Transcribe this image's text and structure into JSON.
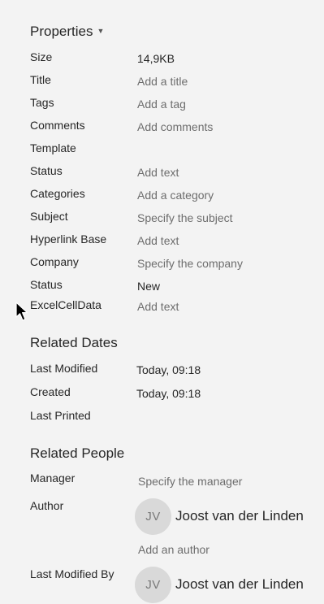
{
  "properties": {
    "title": "Properties",
    "caret_icon": "chevron-down-icon",
    "rows": [
      {
        "label": "Size",
        "value": "14,9KB"
      },
      {
        "label": "Title",
        "value": "Add a title"
      },
      {
        "label": "Tags",
        "value": "Add a tag"
      },
      {
        "label": "Comments",
        "value": "Add comments"
      },
      {
        "label": "Template",
        "value": ""
      },
      {
        "label": "Status",
        "value": "Add text"
      },
      {
        "label": "Categories",
        "value": "Add a category"
      },
      {
        "label": "Subject",
        "value": "Specify the subject"
      },
      {
        "label": "Hyperlink Base",
        "value": "Add text"
      },
      {
        "label": "Company",
        "value": "Specify the company"
      },
      {
        "label": "Status",
        "value": "New"
      },
      {
        "label": "ExcelCellData",
        "value": "Add text"
      }
    ]
  },
  "related_dates": {
    "title": "Related Dates",
    "rows": [
      {
        "label": "Last Modified",
        "value": "Today, 09:18"
      },
      {
        "label": "Created",
        "value": "Today, 09:18"
      },
      {
        "label": "Last Printed",
        "value": ""
      }
    ]
  },
  "related_people": {
    "title": "Related People",
    "manager": {
      "label": "Manager",
      "value": "Specify the manager"
    },
    "author": {
      "label": "Author",
      "initials": "JV",
      "name": "Joost van der Linden",
      "add_label": "Add an author"
    },
    "last_modified_by": {
      "label": "Last Modified By",
      "initials": "JV",
      "name": "Joost van der Linden"
    }
  },
  "colors": {
    "background": "#f3f3f3",
    "text": "#262626",
    "placeholder": "#6d6d6d",
    "avatar": "#d9d9d9"
  }
}
